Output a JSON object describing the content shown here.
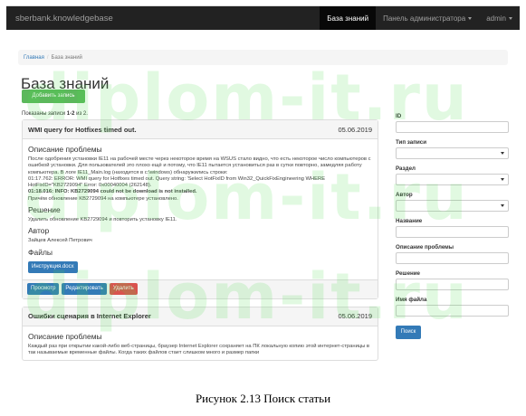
{
  "navbar": {
    "brand": "sberbank.knowledgebase",
    "items": [
      "База знаний",
      "Панель администратора",
      "admin"
    ]
  },
  "breadcrumb": {
    "home": "Главная",
    "separator": "/",
    "current": "База знаний"
  },
  "page": {
    "title": "База знаний",
    "add_button": "Добавить запись",
    "summary_prefix": "Показаны записи ",
    "summary_range": "1-2",
    "summary_suffix": " из 2."
  },
  "articles": [
    {
      "title": "WMI query for Hotfixes timed out.",
      "date": "05.06.2019",
      "problem_heading": "Описание проблемы",
      "problem_text": "После одобрения установки IE11 на рабочей месте через некоторое время на WSUS стало видно, что есть некоторое число компьютеров с ошибкой установки. Для пользователей это плохо ещё и потому, что IE11 пытается установиться раз в сутки повторно, замедляя работу компьютера. В логе IE11_Main.log (находится в c:\\windows) обнаружились строки:",
      "log_line_1": "01:17.762: ERROR: WMI query for Hotfixes timed out. Query string: 'Select HotFixID from Win32_QuickFixEngineering WHERE HotFixID=\"KB2729094\" Error: 0x00040004 (262148).",
      "log_line_2": "01:18.016: INFO: KB2729094 could not be download is not installed.",
      "log_line_3": "Причём обновление KB2729094 на компьютере установлено.",
      "solution_heading": "Решение",
      "solution_text": "Удалить обновление KB2729094 и повторить установку IE11.",
      "author_heading": "Автор",
      "author_name": "Зайцев Алексей Петрович",
      "files_heading": "Файлы",
      "file_button": "Инструкция.docx",
      "actions": {
        "view": "Просмотр",
        "edit": "Редактировать",
        "delete": "Удалить"
      }
    },
    {
      "title": "Ошибки сценария в Internet Explorer",
      "date": "05.06.2019",
      "problem_heading": "Описание проблемы",
      "problem_text": "Каждый раз при открытии какой-либо веб-страницы, браузер Internet Explorer сохраняет на ПК локальную копию этой интернет-страницы в так называемые временные файлы. Когда таких файлов стает слишком много и размер папки"
    }
  ],
  "filters": {
    "id_label": "ID",
    "type_label": "Тип записи",
    "section_label": "Раздел",
    "author_label": "Автор",
    "name_label": "Название",
    "problem_label": "Описание проблемы",
    "solution_label": "Решение",
    "filename_label": "Имя файла",
    "search_button": "Поиск"
  },
  "watermark": "diplom-it.ru",
  "caption": "Рисунок 2.13 Поиск статьи"
}
